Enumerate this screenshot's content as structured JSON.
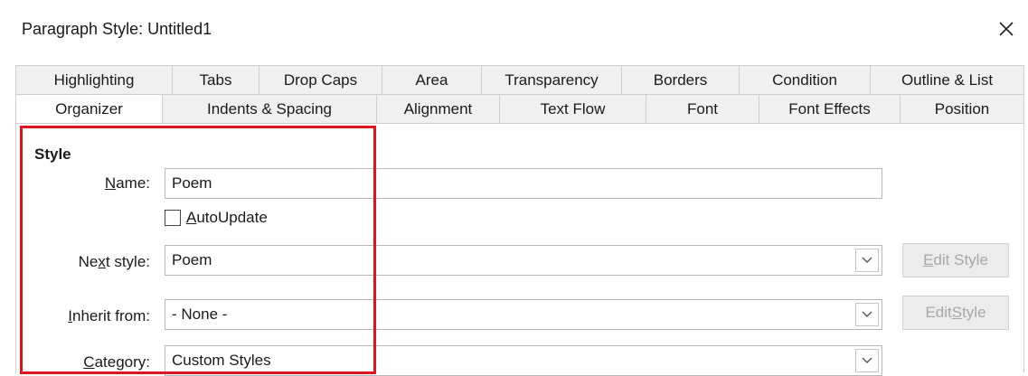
{
  "dialog": {
    "title": "Paragraph Style: Untitled1"
  },
  "tabs": {
    "back_row": [
      {
        "label": "Highlighting"
      },
      {
        "label": "Tabs"
      },
      {
        "label": "Drop Caps"
      },
      {
        "label": "Area"
      },
      {
        "label": "Transparency"
      },
      {
        "label": "Borders"
      },
      {
        "label": "Condition"
      },
      {
        "label": "Outline & List"
      }
    ],
    "front_row": [
      {
        "label": "Organizer"
      },
      {
        "label": "Indents & Spacing"
      },
      {
        "label": "Alignment"
      },
      {
        "label": "Text Flow"
      },
      {
        "label": "Font"
      },
      {
        "label": "Font Effects"
      },
      {
        "label": "Position"
      }
    ],
    "active": "Organizer"
  },
  "style": {
    "section_title": "Style",
    "name": {
      "label_prefix": "",
      "label_accel": "N",
      "label_suffix": "ame:",
      "value": "Poem"
    },
    "autoupdate": {
      "label_prefix": "",
      "label_accel": "A",
      "label_suffix": "utoUpdate",
      "checked": false
    },
    "next_style": {
      "label_prefix": "Ne",
      "label_accel": "x",
      "label_suffix": "t style:",
      "value": "Poem",
      "button": {
        "prefix": "",
        "accel": "E",
        "suffix": "dit Style"
      }
    },
    "inherit_from": {
      "label_prefix": "",
      "label_accel": "I",
      "label_suffix": "nherit from:",
      "value": "- None -",
      "button": {
        "prefix": "Edit ",
        "accel": "S",
        "suffix": "tyle"
      }
    },
    "category": {
      "label_prefix": "",
      "label_accel": "C",
      "label_suffix": "ategory:",
      "value": "Custom Styles"
    }
  },
  "colors": {
    "highlight": "#e0141e",
    "disabled_text": "#a7a7a7"
  }
}
